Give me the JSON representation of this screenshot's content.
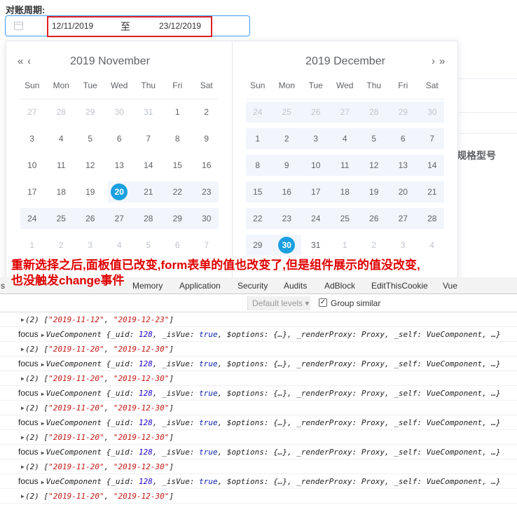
{
  "form": {
    "label": "对账周期:",
    "start": "12/11/2019",
    "separator": "至",
    "end": "23/12/2019"
  },
  "background": {
    "column_header": "规格型号"
  },
  "weekdays": [
    "Sun",
    "Mon",
    "Tue",
    "Wed",
    "Thu",
    "Fri",
    "Sat"
  ],
  "left_panel": {
    "title": "2019 November",
    "prev_year": "«",
    "prev_month": "‹",
    "weeks": [
      [
        "27",
        "28",
        "29",
        "30",
        "31",
        "1",
        "2"
      ],
      [
        "3",
        "4",
        "5",
        "6",
        "7",
        "8",
        "9"
      ],
      [
        "10",
        "11",
        "12",
        "13",
        "14",
        "15",
        "16"
      ],
      [
        "17",
        "18",
        "19",
        "20",
        "21",
        "22",
        "23"
      ],
      [
        "24",
        "25",
        "26",
        "27",
        "28",
        "29",
        "30"
      ],
      [
        "1",
        "2",
        "3",
        "4",
        "5",
        "6",
        "7"
      ]
    ]
  },
  "right_panel": {
    "title": "2019 December",
    "next_month": "›",
    "next_year": "»",
    "weeks": [
      [
        "24",
        "25",
        "26",
        "27",
        "28",
        "29",
        "30"
      ],
      [
        "1",
        "2",
        "3",
        "4",
        "5",
        "6",
        "7"
      ],
      [
        "8",
        "9",
        "10",
        "11",
        "12",
        "13",
        "14"
      ],
      [
        "15",
        "16",
        "17",
        "18",
        "19",
        "20",
        "21"
      ],
      [
        "22",
        "23",
        "24",
        "25",
        "26",
        "27",
        "28"
      ],
      [
        "29",
        "30",
        "31",
        "1",
        "2",
        "3",
        "4"
      ]
    ]
  },
  "selection": {
    "start": "2019-11-20",
    "end": "2019-12-30"
  },
  "annotation": {
    "line1": "重新选择之后,面板值已改变,form表单的值也改变了,但是组件展示的值没改变,",
    "line2": "也没触发change事件"
  },
  "devtools": {
    "tabs": [
      "s",
      "Memory",
      "Application",
      "Security",
      "Audits",
      "AdBlock",
      "EditThisCookie",
      "Vue"
    ],
    "levels": "Default levels ▾",
    "group_similar": "Group similar",
    "rows": [
      {
        "type": "arr",
        "a": "\"2019-11-12\"",
        "b": "\"2019-12-23\""
      },
      {
        "type": "log",
        "label": "focus"
      },
      {
        "type": "arr",
        "a": "\"2019-11-20\"",
        "b": "\"2019-12-30\""
      },
      {
        "type": "log",
        "label": "focus"
      },
      {
        "type": "arr",
        "a": "\"2019-11-20\"",
        "b": "\"2019-12-30\""
      },
      {
        "type": "log",
        "label": "focus"
      },
      {
        "type": "arr",
        "a": "\"2019-11-20\"",
        "b": "\"2019-12-30\""
      },
      {
        "type": "log",
        "label": "focus"
      },
      {
        "type": "arr",
        "a": "\"2019-11-20\"",
        "b": "\"2019-12-30\""
      },
      {
        "type": "log",
        "label": "focus"
      },
      {
        "type": "arr",
        "a": "\"2019-11-20\"",
        "b": "\"2019-12-30\""
      },
      {
        "type": "log",
        "label": "focus"
      },
      {
        "type": "arr",
        "a": "\"2019-11-20\"",
        "b": "\"2019-12-30\""
      }
    ],
    "vue_obj": {
      "name": "VueComponent",
      "uid_key": "_uid",
      "uid": "128",
      "isvue_key": "_isVue",
      "isvue": "true",
      "rest": "$options: {…}, _renderProxy: Proxy, _self: VueComponent, …}"
    },
    "arr_count": "(2)"
  }
}
